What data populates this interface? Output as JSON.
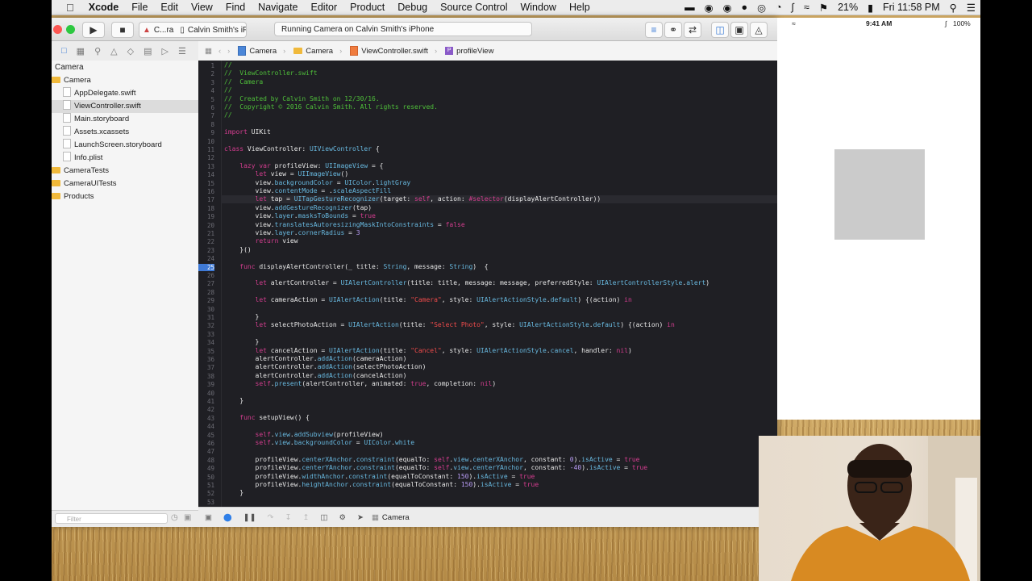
{
  "menubar": {
    "app_name": "Xcode",
    "items": [
      "File",
      "Edit",
      "View",
      "Find",
      "Navigate",
      "Editor",
      "Product",
      "Debug",
      "Source Control",
      "Window",
      "Help"
    ],
    "battery": "21%",
    "clock": "Fri 11:58 PM"
  },
  "toolbar": {
    "scheme_target": "C...ra",
    "scheme_device": "Calvin Smith's iPhone",
    "activity_status": "Running Camera on Calvin Smith's iPhone"
  },
  "navigator": {
    "root": "Camera",
    "items": [
      {
        "label": "Camera",
        "kind": "folder"
      },
      {
        "label": "AppDelegate.swift",
        "kind": "file"
      },
      {
        "label": "ViewController.swift",
        "kind": "file",
        "selected": true
      },
      {
        "label": "Main.storyboard",
        "kind": "file"
      },
      {
        "label": "Assets.xcassets",
        "kind": "file"
      },
      {
        "label": "LaunchScreen.storyboard",
        "kind": "file"
      },
      {
        "label": "Info.plist",
        "kind": "file"
      },
      {
        "label": "CameraTests",
        "kind": "folder"
      },
      {
        "label": "CameraUITests",
        "kind": "folder"
      },
      {
        "label": "Products",
        "kind": "folder"
      }
    ],
    "filter_placeholder": "Filter"
  },
  "jumpbar": {
    "crumbs": [
      "Camera",
      "Camera",
      "ViewController.swift",
      "profileView"
    ]
  },
  "editor": {
    "current_line": 17,
    "breakpoint_line": 25,
    "line_numbers": [
      "1",
      "2",
      "3",
      "4",
      "5",
      "6",
      "7",
      "8",
      "9",
      "10",
      "11",
      "12",
      "13",
      "14",
      "15",
      "16",
      "17",
      "18",
      "19",
      "20",
      "21",
      "22",
      "23",
      "24",
      "25",
      "26",
      "27",
      "28",
      "29",
      "30",
      "31",
      "32",
      "33",
      "34",
      "35",
      "36",
      "37",
      "38",
      "39",
      "40",
      "41",
      "42",
      "43",
      "44",
      "45",
      "46",
      "47",
      "48",
      "49",
      "50",
      "51",
      "52",
      "53"
    ]
  },
  "debugbar": {
    "target": "Camera"
  },
  "simulator": {
    "time": "9:41 AM",
    "battery": "100%"
  },
  "colors": {
    "comment": "#4fbf3a",
    "keyword": "#d43d8f",
    "type": "#68b9e0",
    "string": "#ef4b4b",
    "editor_bg": "#1f1f24"
  }
}
